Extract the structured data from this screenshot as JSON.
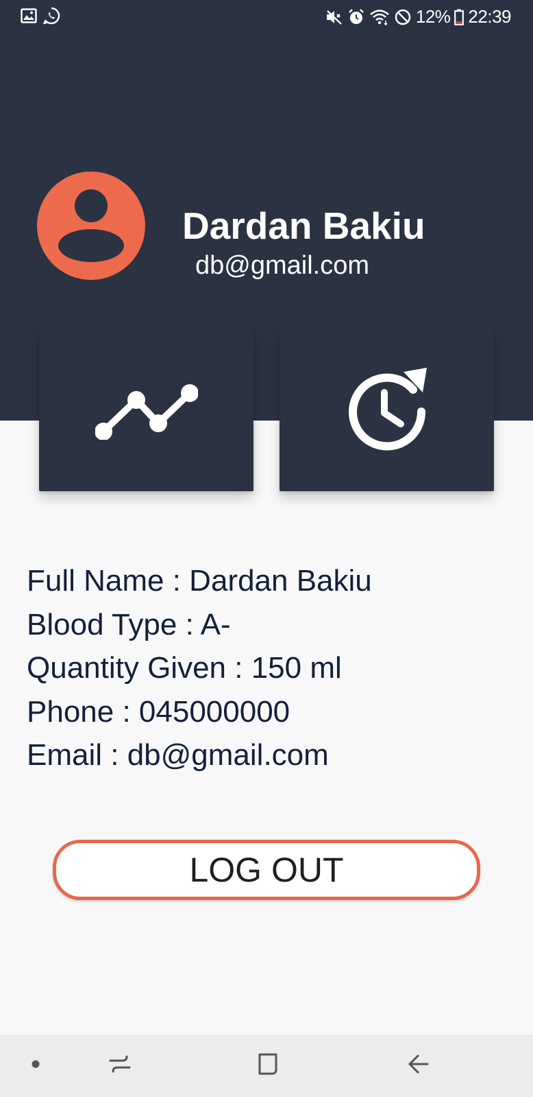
{
  "status_bar": {
    "battery_percent": "12%",
    "time": "22:39",
    "left_icons": [
      "gallery-icon",
      "whatsapp-icon"
    ],
    "right_icons": [
      "mute-icon",
      "alarm-icon",
      "wifi-icon",
      "do-not-disturb-icon",
      "battery-icon"
    ]
  },
  "profile": {
    "name": "Dardan Bakiu",
    "email": "db@gmail.com"
  },
  "cards": [
    {
      "icon": "trend-line-icon"
    },
    {
      "icon": "history-icon"
    }
  ],
  "info": {
    "full_name": "Full Name : Dardan Bakiu",
    "blood_type": "Blood Type : A-",
    "quantity_given": "Quantity Given : 150 ml",
    "phone": "Phone : 045000000",
    "email": "Email : db@gmail.com"
  },
  "logout_label": "LOG OUT",
  "nav_bar": {
    "icons": [
      "nav-dot-icon",
      "recent-apps-icon",
      "home-icon",
      "back-icon"
    ]
  },
  "colors": {
    "header_bg": "#2b3242",
    "accent": "#ee6a4c",
    "page_bg": "#f8f8f8",
    "text_dark": "#14203a"
  }
}
